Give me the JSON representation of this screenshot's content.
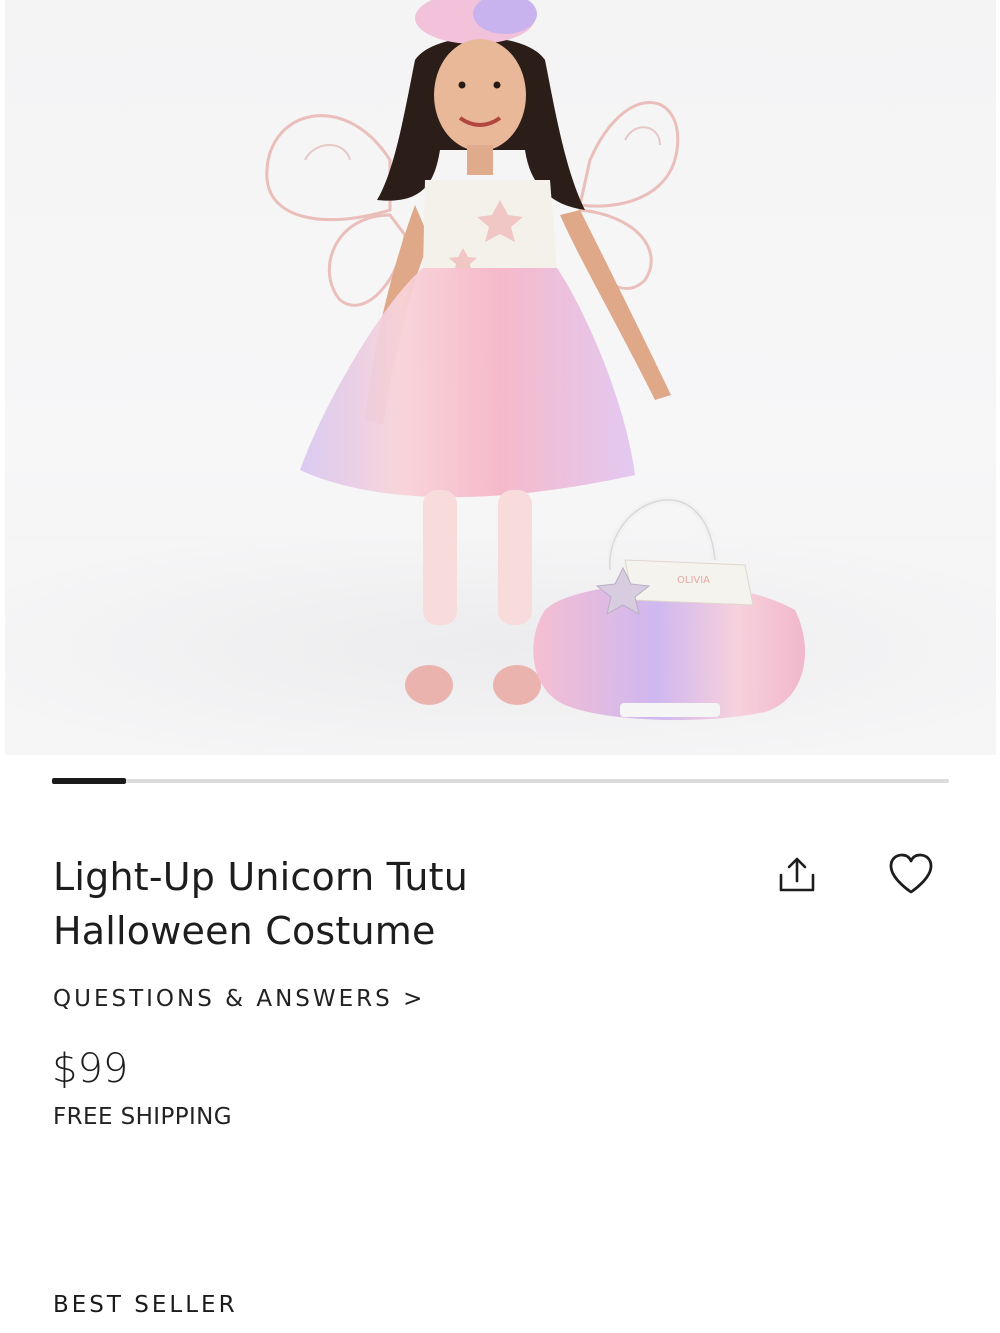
{
  "product": {
    "image": {
      "alt": "Child wearing a light-up unicorn tutu costume with fairy wings and a matching tutu treat bag",
      "bag_tag": "OLIVIA"
    },
    "gallery": {
      "current_index": 1,
      "total_images": 12,
      "progress_fraction": 0.083
    },
    "title_line1": "Light-Up Unicorn Tutu",
    "title_line2": "Halloween Costume",
    "qa_link": "QUESTIONS & ANSWERS >",
    "price": "$99",
    "shipping": "FREE SHIPPING",
    "badge": "BEST SELLER"
  },
  "icons": {
    "share": "share-icon",
    "favorite": "heart-icon"
  },
  "colors": {
    "text": "#1f1f1f",
    "progress_track": "#dcdcdc",
    "progress_fill": "#1a1a1a",
    "tutu_pink": "#f4b8cc",
    "tutu_lavender": "#c9b3ee"
  }
}
